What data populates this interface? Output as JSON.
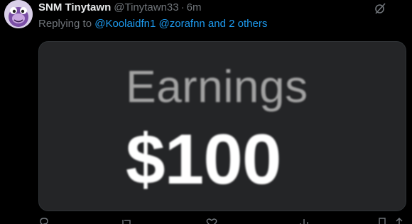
{
  "tweet": {
    "display_name": "SNM Tinytawn",
    "handle": "@Tinytawn33",
    "separator": "·",
    "time": "6m",
    "replying_label": "Replying to",
    "replying_targets": "@Koolaidfn1 @zorafnn and 2 others"
  },
  "media": {
    "title": "Earnings",
    "value": "$100"
  },
  "icons": {
    "avatar": "avatar-image",
    "mute": "mute-icon",
    "reply": "reply-icon",
    "retweet": "retweet-icon",
    "like": "like-icon",
    "views": "views-icon",
    "bookmark": "bookmark-icon",
    "share": "share-icon"
  },
  "colors": {
    "background": "#000000",
    "text_primary": "#e7e9ea",
    "text_secondary": "#71767b",
    "link": "#1d9bf0",
    "media_background": "#242527"
  }
}
